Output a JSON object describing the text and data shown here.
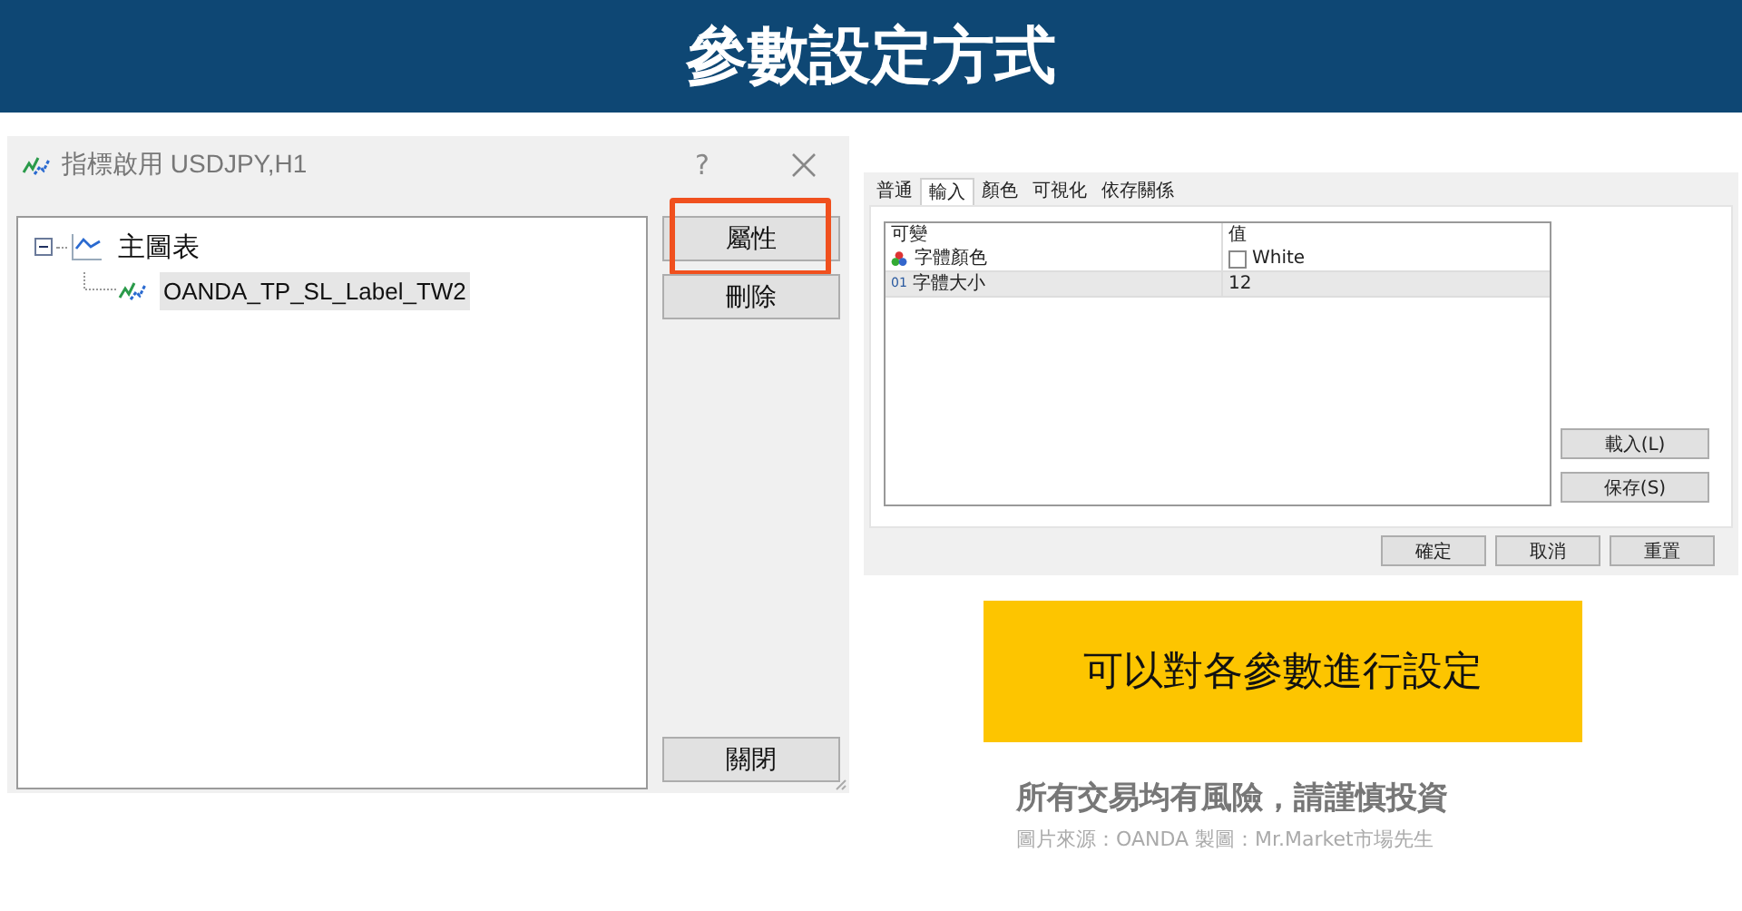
{
  "header": {
    "title": "參數設定方式"
  },
  "indicator_dialog": {
    "title": "指標啟用 USDJPY,H1",
    "help": "?",
    "tree": [
      {
        "label": "主圖表",
        "expanded": true,
        "children": [
          {
            "label": "OANDA_TP_SL_Label_TW2",
            "selected": true
          }
        ]
      }
    ],
    "actions": [
      {
        "label": "屬性",
        "highlighted": true
      },
      {
        "label": "刪除",
        "highlighted": false
      }
    ],
    "close_button": "關閉"
  },
  "properties_dialog": {
    "tabs": [
      {
        "label": "普通",
        "selected": false
      },
      {
        "label": "輸入",
        "selected": true
      },
      {
        "label": "顏色",
        "selected": false
      },
      {
        "label": "可視化",
        "selected": false
      },
      {
        "label": "依存關係",
        "selected": false
      }
    ],
    "columns": [
      "可變",
      "值"
    ],
    "rows": [
      {
        "kind": "color",
        "name": "字體顏色",
        "value": "White",
        "color": "#ffffff",
        "selected": false
      },
      {
        "kind": "number",
        "badge": "01",
        "name": "字體大小",
        "value": "12",
        "selected": true
      }
    ],
    "side_buttons": [
      "載入(L)",
      "保存(S)"
    ],
    "footer_buttons": [
      "確定",
      "取消",
      "重置"
    ]
  },
  "callout": "可以對各參數進行設定",
  "disclaimer": "所有交易均有風險，請謹慎投資",
  "credit": "圖片來源：OANDA 製圖：Mr.Market市場先生"
}
